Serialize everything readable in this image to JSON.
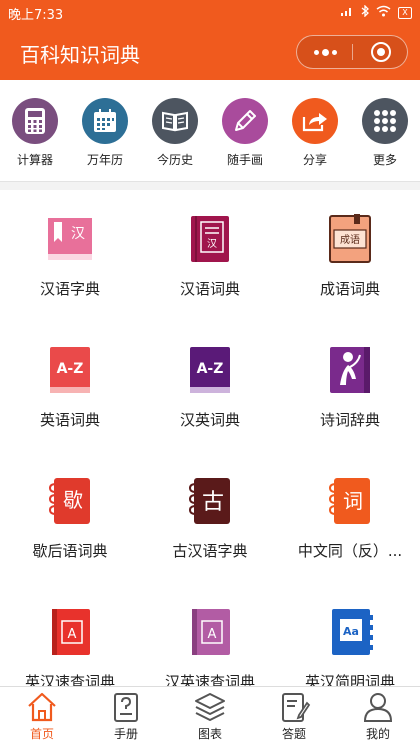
{
  "status_bar": {
    "time": "晚上7:33",
    "battery": "X"
  },
  "header": {
    "title": "百科知识词典"
  },
  "colors": {
    "brand": "#f05a1e",
    "active_tab": "#f05a1e"
  },
  "toolbar": {
    "items": [
      {
        "label": "计算器",
        "icon": "calculator-icon",
        "color": "#7a4e7f"
      },
      {
        "label": "万年历",
        "icon": "calendar-icon",
        "color": "#2d6f96"
      },
      {
        "label": "今历史",
        "icon": "open-book-icon",
        "color": "#4d5560"
      },
      {
        "label": "随手画",
        "icon": "pencil-icon",
        "color": "#a94b9c"
      },
      {
        "label": "分享",
        "icon": "share-icon",
        "color": "#f05a1e"
      },
      {
        "label": "更多",
        "icon": "more-grid-icon",
        "color": "#4d5560"
      }
    ]
  },
  "dictionaries": {
    "items": [
      {
        "label": "汉语字典",
        "icon": "hanyu-zidian-icon",
        "color": "#e8709a",
        "glyph": "汉"
      },
      {
        "label": "汉语词典",
        "icon": "hanyu-cidian-icon",
        "color": "#a0154c",
        "glyph": "汉"
      },
      {
        "label": "成语词典",
        "icon": "chengyu-cidian-icon",
        "color": "#f3a27e",
        "glyph": "成语"
      },
      {
        "label": "英语词典",
        "icon": "english-dictionary-icon",
        "color": "#ea4a4a",
        "glyph": "A-Z"
      },
      {
        "label": "汉英词典",
        "icon": "chinese-english-dictionary-icon",
        "color": "#5a1a78",
        "glyph": "A-Z"
      },
      {
        "label": "诗词辞典",
        "icon": "poetry-dictionary-icon",
        "color": "#7a2a8c",
        "glyph": ""
      },
      {
        "label": "歇后语词典",
        "icon": "xiehouyu-dictionary-icon",
        "color": "#e03a2c",
        "glyph": "歇"
      },
      {
        "label": "古汉语字典",
        "icon": "ancient-chinese-dictionary-icon",
        "color": "#5a1a1a",
        "glyph": "古"
      },
      {
        "label": "中文同（反）...",
        "icon": "synonym-antonym-dictionary-icon",
        "color": "#f05a1e",
        "glyph": "词"
      },
      {
        "label": "英汉速查词典",
        "icon": "english-chinese-quick-dictionary-icon",
        "color": "#e8322c",
        "glyph": "A"
      },
      {
        "label": "汉英速查词典",
        "icon": "chinese-english-quick-dictionary-icon",
        "color": "#b25ca4",
        "glyph": "A"
      },
      {
        "label": "英汉简明词典",
        "icon": "english-chinese-concise-dictionary-icon",
        "color": "#1c63c4",
        "glyph": "Aa"
      }
    ]
  },
  "tabbar": {
    "items": [
      {
        "label": "首页",
        "icon": "home-icon",
        "active": true
      },
      {
        "label": "手册",
        "icon": "manual-icon",
        "active": false
      },
      {
        "label": "图表",
        "icon": "layers-icon",
        "active": false
      },
      {
        "label": "答题",
        "icon": "quiz-icon",
        "active": false
      },
      {
        "label": "我的",
        "icon": "profile-icon",
        "active": false
      }
    ]
  }
}
